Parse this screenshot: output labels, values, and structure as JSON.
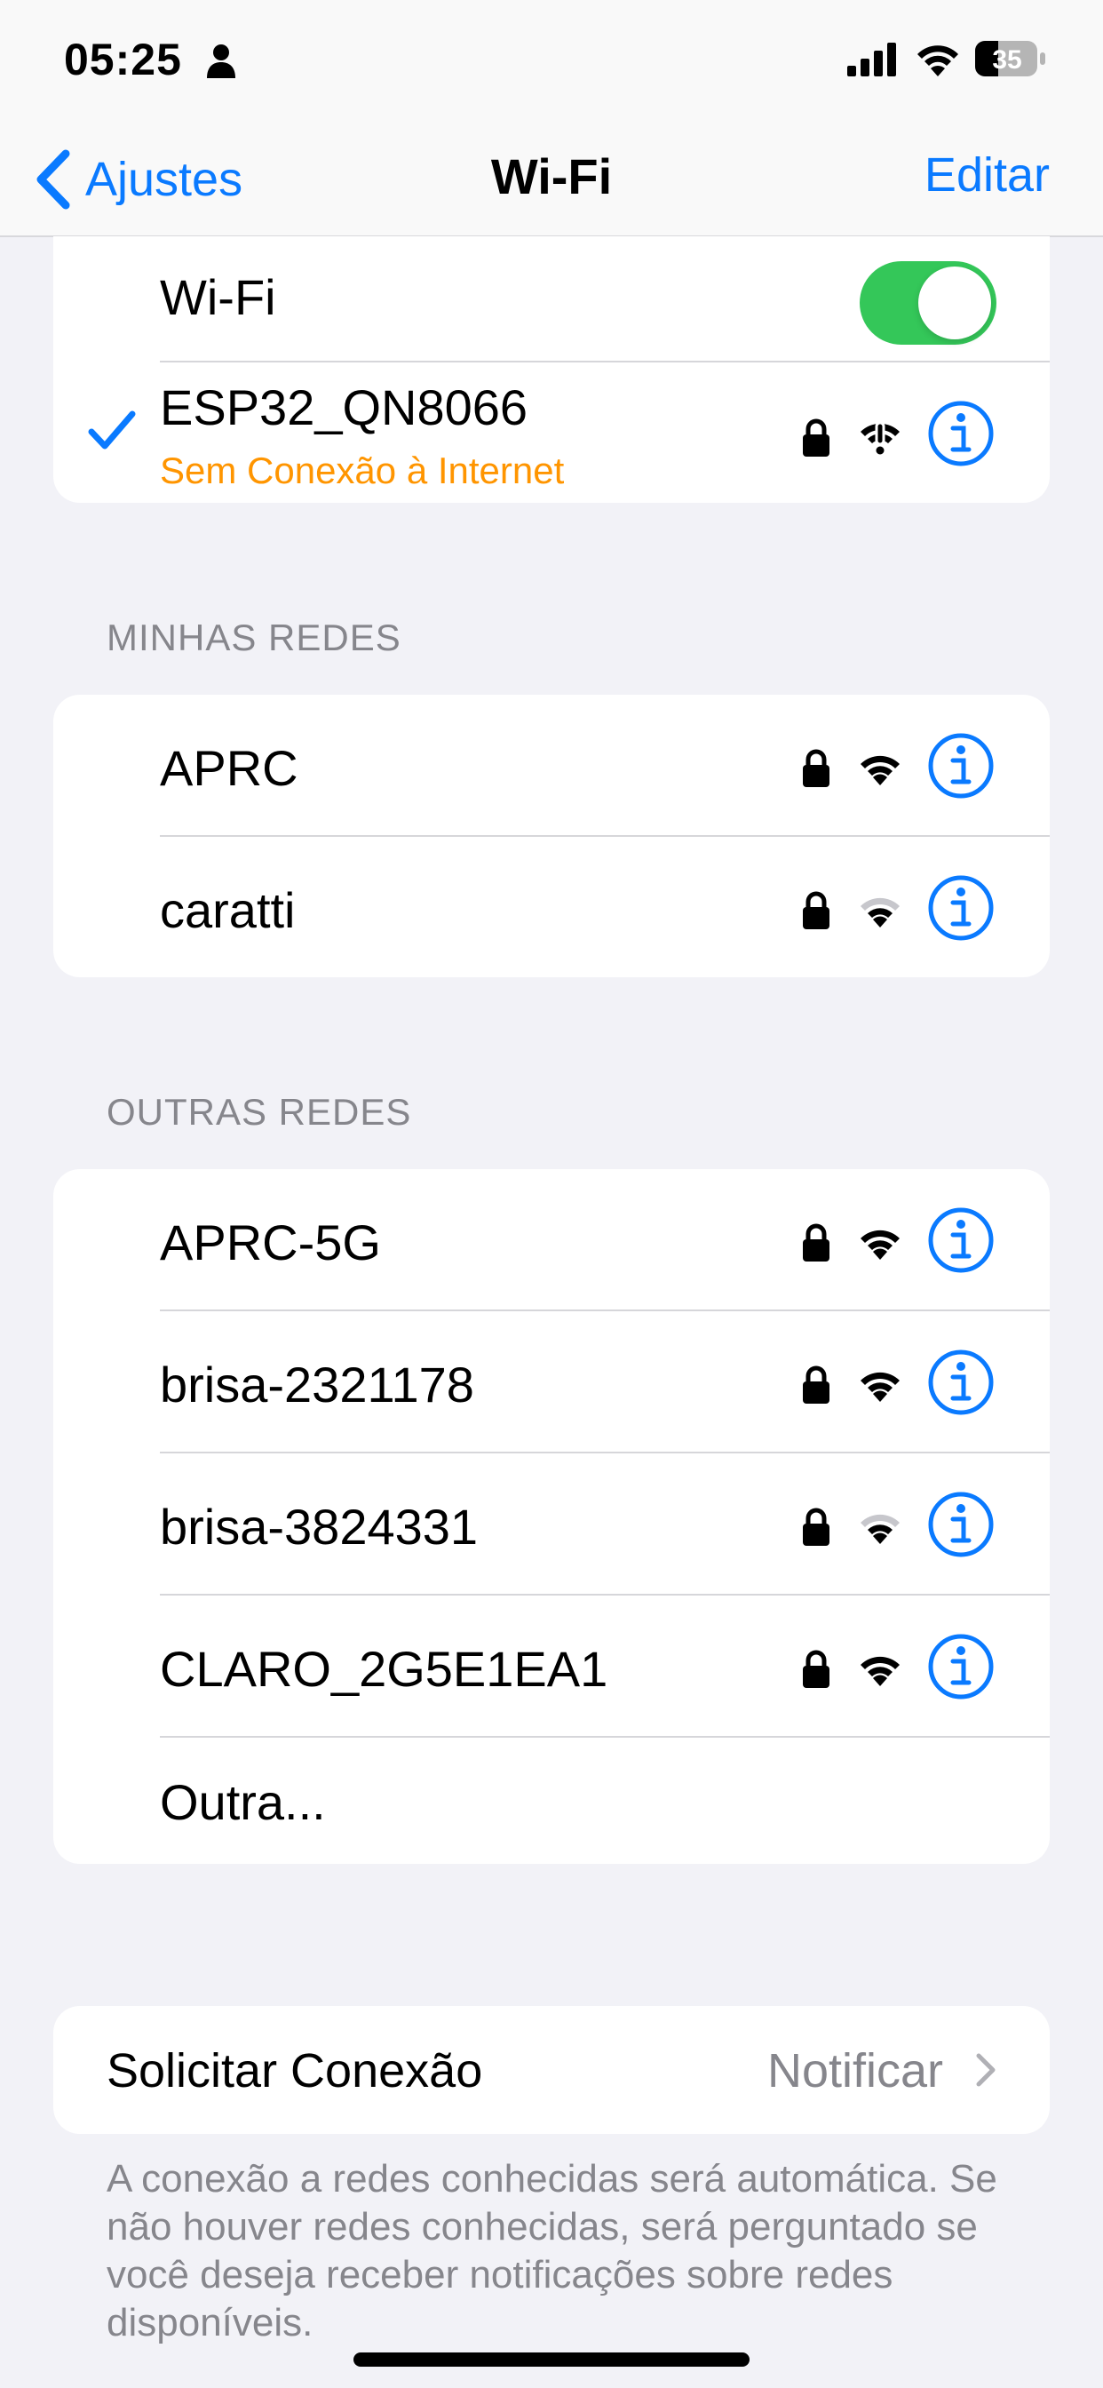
{
  "status_bar": {
    "time": "05:25",
    "battery": "35"
  },
  "nav": {
    "back_label": "Ajustes",
    "title": "Wi-Fi",
    "edit_label": "Editar"
  },
  "wifi_toggle": {
    "label": "Wi-Fi",
    "on": true
  },
  "connected": {
    "name": "ESP32_QN8066",
    "status": "Sem Conexão à Internet"
  },
  "my_networks": {
    "header": "MINHAS REDES",
    "items": [
      {
        "name": "APRC",
        "signal": "full"
      },
      {
        "name": "caratti",
        "signal": "weak"
      }
    ]
  },
  "other_networks": {
    "header": "OUTRAS REDES",
    "items": [
      {
        "name": "APRC-5G",
        "signal": "full"
      },
      {
        "name": "brisa-2321178",
        "signal": "full"
      },
      {
        "name": "brisa-3824331",
        "signal": "weak"
      },
      {
        "name": "CLARO_2G5E1EA1",
        "signal": "full"
      }
    ],
    "other_label": "Outra..."
  },
  "ask_join": {
    "label": "Solicitar Conexão",
    "value": "Notificar"
  },
  "footer_text": "A conexão a redes conhecidas será automática. Se não houver redes conhecidas, será perguntado se você deseja receber notificações sobre redes disponíveis.",
  "colors": {
    "accent": "#0a7aff",
    "toggle_on": "#34c759",
    "warning": "#ff9500",
    "secondary": "#86868c"
  }
}
